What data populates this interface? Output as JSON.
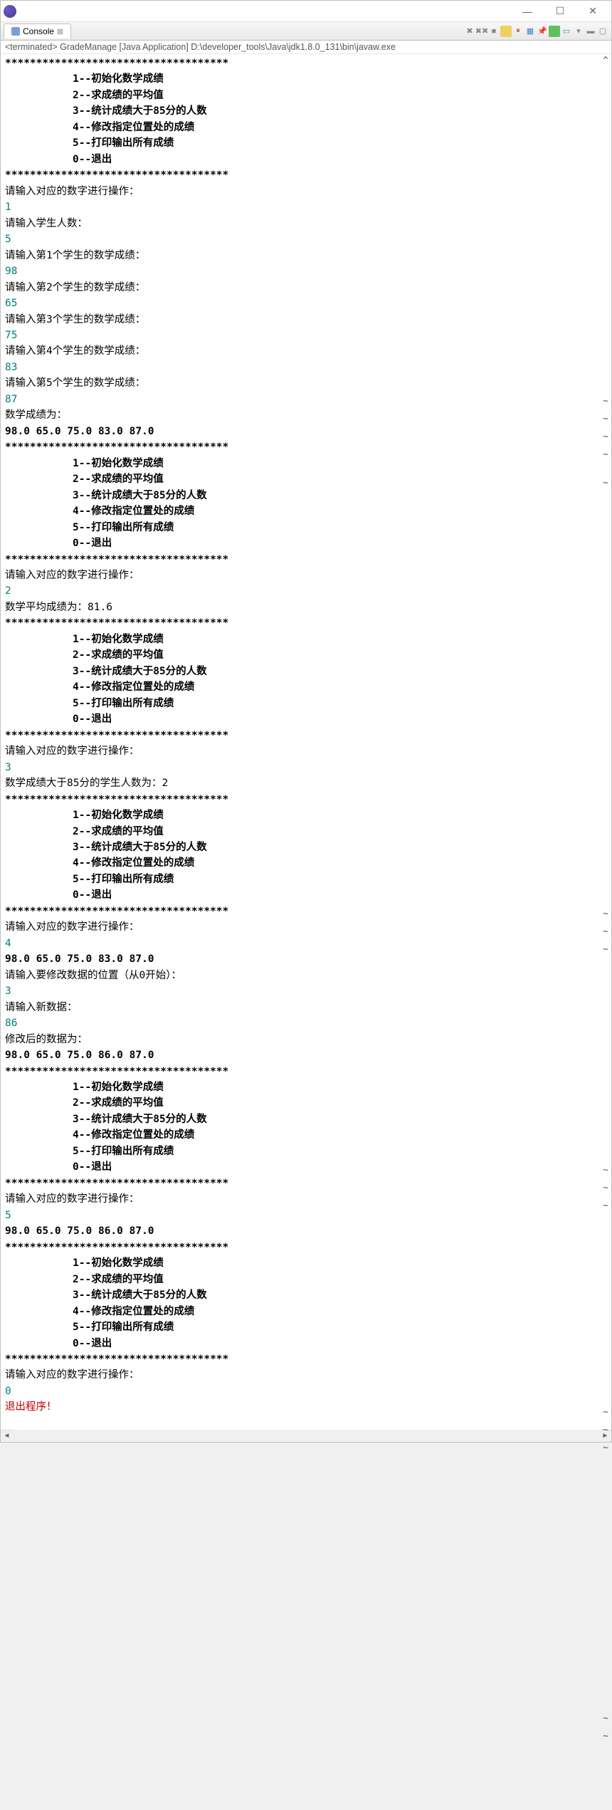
{
  "window": {
    "tab_label": "Console",
    "tab_icon_name": "console-icon",
    "path": "<terminated> GradeManage [Java Application] D:\\developer_tools\\Java\\jdk1.8.0_131\\bin\\javaw.exe"
  },
  "menu_text": {
    "star_line": "************************************",
    "opt1": "1--初始化数学成绩",
    "opt2": "2--求成绩的平均值",
    "opt3": "3--统计成绩大于85分的人数",
    "opt4": "4--修改指定位置处的成绩",
    "opt5": "5--打印输出所有成绩",
    "opt0": "0--退出",
    "prompt": "请输入对应的数字进行操作：",
    "prompt_count": "请输入学生人数：",
    "score_label": "数学成绩为：",
    "avg_label": "数学平均成绩为：81.6",
    "gt85_label": "数学成绩大于85分的学生人数为：2",
    "prompt_pos": "请输入要修改数据的位置（从0开始）：",
    "prompt_new": "请输入新数据：",
    "after_mod": "修改后的数据为：",
    "exit_msg": "退出程序！"
  },
  "prompts_student": [
    "请输入第1个学生的数学成绩：",
    "请输入第2个学生的数学成绩：",
    "请输入第3个学生的数学成绩：",
    "请输入第4个学生的数学成绩：",
    "请输入第5个学生的数学成绩："
  ],
  "inputs": {
    "choice1": "1",
    "count": "5",
    "scores": [
      "98",
      "65",
      "75",
      "83",
      "87"
    ],
    "choice2": "2",
    "choice3": "3",
    "choice4": "4",
    "pos": "3",
    "newval": "86",
    "choice5": "5",
    "choice0": "0"
  },
  "outputs": {
    "scores1": "98.0 65.0 75.0 83.0 87.0 ",
    "scores2": "98.0 65.0 75.0 86.0 87.0 "
  },
  "marks": {
    "caret": "^",
    "tilde": "~"
  }
}
